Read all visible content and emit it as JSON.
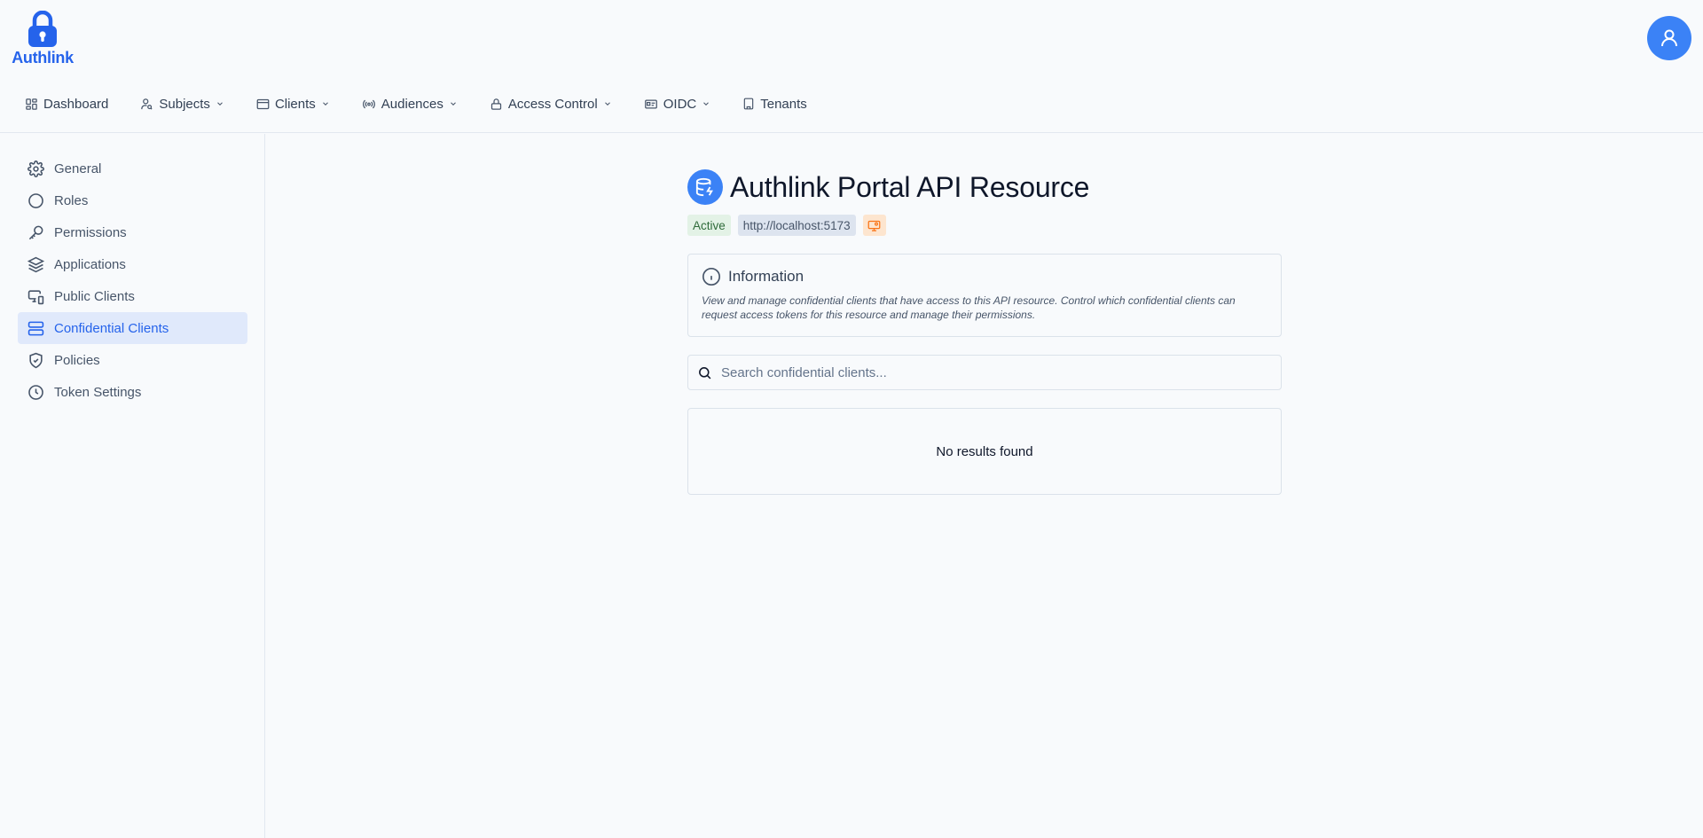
{
  "app": {
    "logo_text": "Authlink"
  },
  "topnav": {
    "items": [
      {
        "label": "Dashboard",
        "icon": "grid-icon",
        "dropdown": false
      },
      {
        "label": "Subjects",
        "icon": "user-search-icon",
        "dropdown": true
      },
      {
        "label": "Clients",
        "icon": "browser-window-icon",
        "dropdown": true
      },
      {
        "label": "Audiences",
        "icon": "broadcast-icon",
        "dropdown": true
      },
      {
        "label": "Access Control",
        "icon": "lock-icon",
        "dropdown": true
      },
      {
        "label": "OIDC",
        "icon": "id-card-icon",
        "dropdown": true
      },
      {
        "label": "Tenants",
        "icon": "building-icon",
        "dropdown": false
      }
    ]
  },
  "sidebar": {
    "items": [
      {
        "label": "General",
        "icon": "gear-icon",
        "active": false
      },
      {
        "label": "Roles",
        "icon": "circle-icon",
        "active": false
      },
      {
        "label": "Permissions",
        "icon": "key-icon",
        "active": false
      },
      {
        "label": "Applications",
        "icon": "layers-icon",
        "active": false
      },
      {
        "label": "Public Clients",
        "icon": "monitor-smartphone-icon",
        "active": false
      },
      {
        "label": "Confidential Clients",
        "icon": "server-icon",
        "active": true
      },
      {
        "label": "Policies",
        "icon": "shield-check-icon",
        "active": false
      },
      {
        "label": "Token Settings",
        "icon": "clock-icon",
        "active": false
      }
    ]
  },
  "main": {
    "title": "Authlink Portal API Resource",
    "status_badge": "Active",
    "url_badge": "http://localhost:5173",
    "info": {
      "title": "Information",
      "text": "View and manage confidential clients that have access to this API resource. Control which confidential clients can request access tokens for this resource and manage their permissions."
    },
    "search": {
      "placeholder": "Search confidential clients...",
      "value": ""
    },
    "empty_text": "No results found"
  },
  "colors": {
    "accent": "#3b82f6",
    "active_bg": "#e0e9fb",
    "status_green_bg": "#e3f2e6",
    "warning_orange": "#f97316"
  }
}
